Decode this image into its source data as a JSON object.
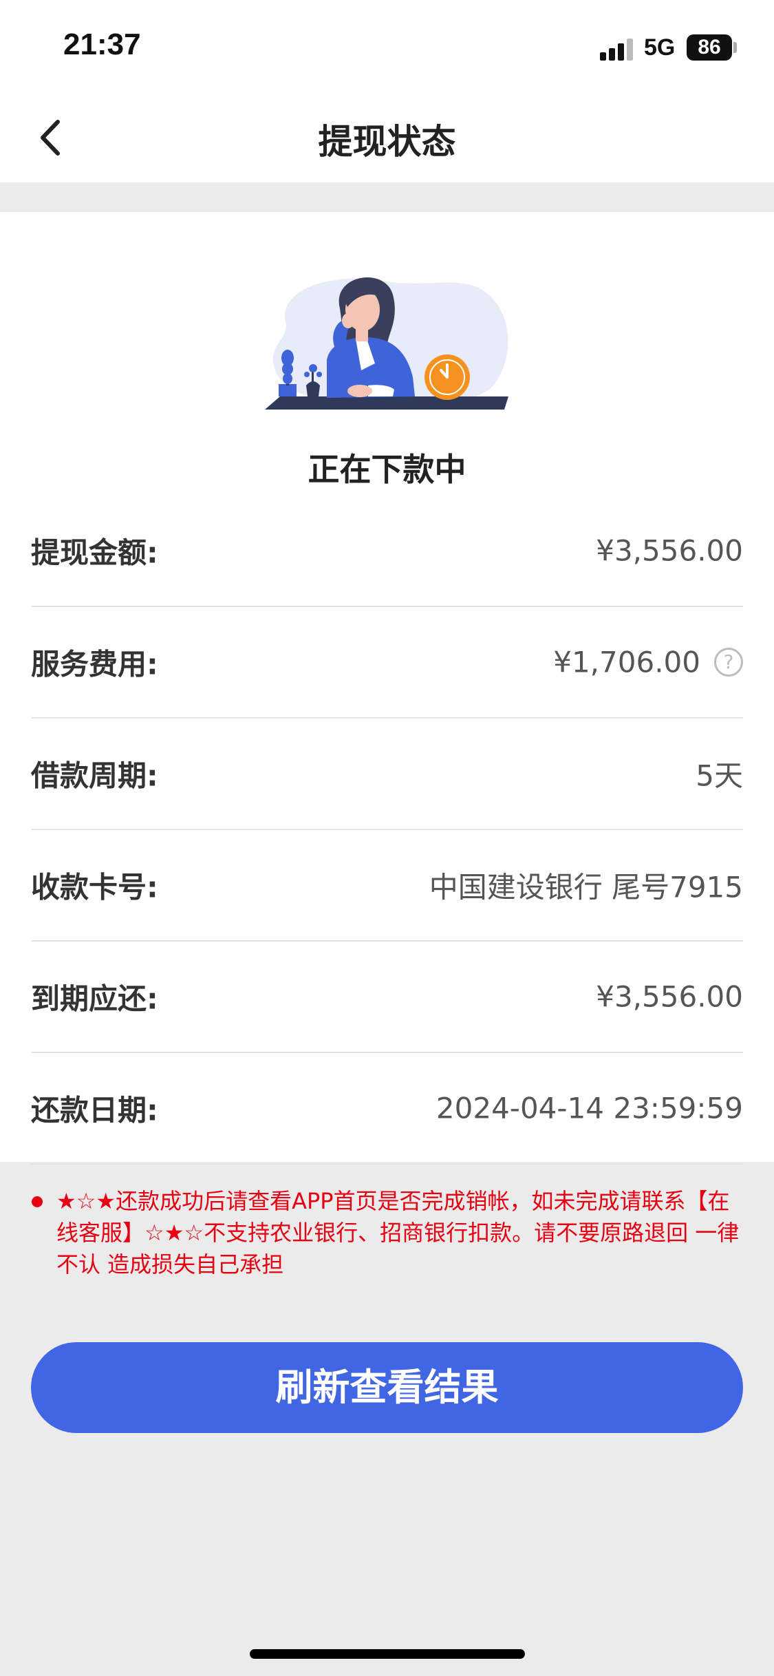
{
  "status_bar": {
    "time": "21:37",
    "network": "5G",
    "battery": "86",
    "icons": [
      "signal-icon",
      "battery-icon"
    ]
  },
  "nav": {
    "title": "提现状态",
    "back_icon": "chevron-left-icon"
  },
  "status": {
    "text": "正在下款中",
    "illustration": "woman-waiting-clock-illustration"
  },
  "details": [
    {
      "label": "提现金额:",
      "value": "¥3,556.00"
    },
    {
      "label": "服务费用:",
      "value": "¥1,706.00"
    },
    {
      "label": "借款周期:",
      "value": "5天"
    },
    {
      "label": "收款卡号:",
      "value": "中国建设银行 尾号7915"
    },
    {
      "label": "到期应还:",
      "value": "¥3,556.00"
    },
    {
      "label": "还款日期:",
      "value": "2024-04-14 23:59:59"
    }
  ],
  "help_icon": "?",
  "notice": {
    "text": "★☆★还款成功后请查看APP首页是否完成销帐，如未完成请联系【在线客服】☆★☆不支持农业银行、招商银行扣款。请不要原路退回 一律不认 造成损失自己承担",
    "color": "#e60012"
  },
  "refresh_button": {
    "label": "刷新查看结果",
    "color": "#4166e3"
  }
}
